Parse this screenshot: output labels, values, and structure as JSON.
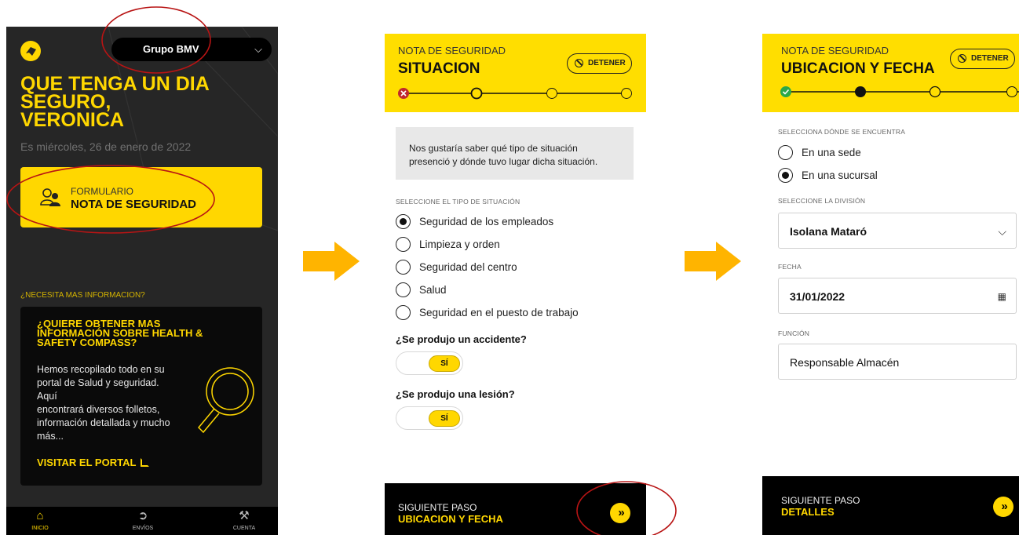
{
  "screen1": {
    "group_selector": "Grupo BMV",
    "greeting_lines": [
      "QUE TENGA UN DIA",
      "SEGURO,",
      "VERONICA"
    ],
    "date": "Es miércoles, 26 de enero de 2022",
    "form_card": {
      "kicker": "FORMULARIO",
      "title": "NOTA DE SEGURIDAD"
    },
    "need_info": "¿NECESITA MAS INFORMACION?",
    "info_card": {
      "heading_lines": [
        "¿QUIERE OBTENER MAS",
        "INFORMACIÓN SOBRE HEALTH &",
        "SAFETY COMPASS?"
      ],
      "body_lines": [
        "Hemos recopilado todo en su",
        "portal de Salud y seguridad. Aquí",
        "encontrará diversos folletos,",
        "información detallada y mucho",
        "más..."
      ],
      "link": "VISITAR EL PORTAL"
    },
    "tabs": [
      {
        "label": "INICIO",
        "icon": "home-icon",
        "active": true
      },
      {
        "label": "ENVÍOS",
        "icon": "send-icon",
        "active": false
      },
      {
        "label": "CUENTA",
        "icon": "wrench-icon",
        "active": false
      }
    ]
  },
  "screen2": {
    "header": {
      "kicker": "NOTA DE SEGURIDAD",
      "title": "SITUACION",
      "stop_label": "DETENER"
    },
    "intro_lines": [
      "Nos gustaría saber qué tipo de situación",
      "presenció y dónde tuvo lugar dicha situación."
    ],
    "type_label": "SELECCIONE EL TIPO DE SITUACIÓN",
    "options": [
      {
        "label": "Seguridad de los empleados",
        "selected": true
      },
      {
        "label": "Limpieza y orden",
        "selected": false
      },
      {
        "label": "Seguridad del centro",
        "selected": false
      },
      {
        "label": "Salud",
        "selected": false
      },
      {
        "label": "Seguridad en el puesto de trabajo",
        "selected": false
      }
    ],
    "q_accident": "¿Se produjo un accidente?",
    "toggle_accident": "SÍ",
    "q_injury": "¿Se produjo una lesión?",
    "toggle_injury": "SÍ",
    "footer": {
      "kicker": "SIGUIENTE PASO",
      "title": "UBICACION Y FECHA"
    }
  },
  "screen3": {
    "header": {
      "kicker": "NOTA DE SEGURIDAD",
      "title": "UBICACION Y FECHA",
      "stop_label": "DETENER"
    },
    "location_label": "SELECCIONA DÓNDE SE ENCUENTRA",
    "location_options": [
      {
        "label": "En una sede",
        "selected": false
      },
      {
        "label": "En una sucursal",
        "selected": true
      }
    ],
    "division_label": "SELECCIONE LA DIVISIÓN",
    "division_value": "Isolana Mataró",
    "date_label": "FECHA",
    "date_value": "31/01/2022",
    "function_label": "FUNCIÓN",
    "function_value": "Responsable Almacén",
    "footer": {
      "kicker": "SIGUIENTE PASO",
      "title": "DETALLES"
    }
  },
  "colors": {
    "brand_yellow": "#ffd700",
    "header_yellow": "#ffde00",
    "dark_bg": "#262626",
    "annotation_red": "#b81414",
    "arrow_orange": "#ffb400"
  }
}
